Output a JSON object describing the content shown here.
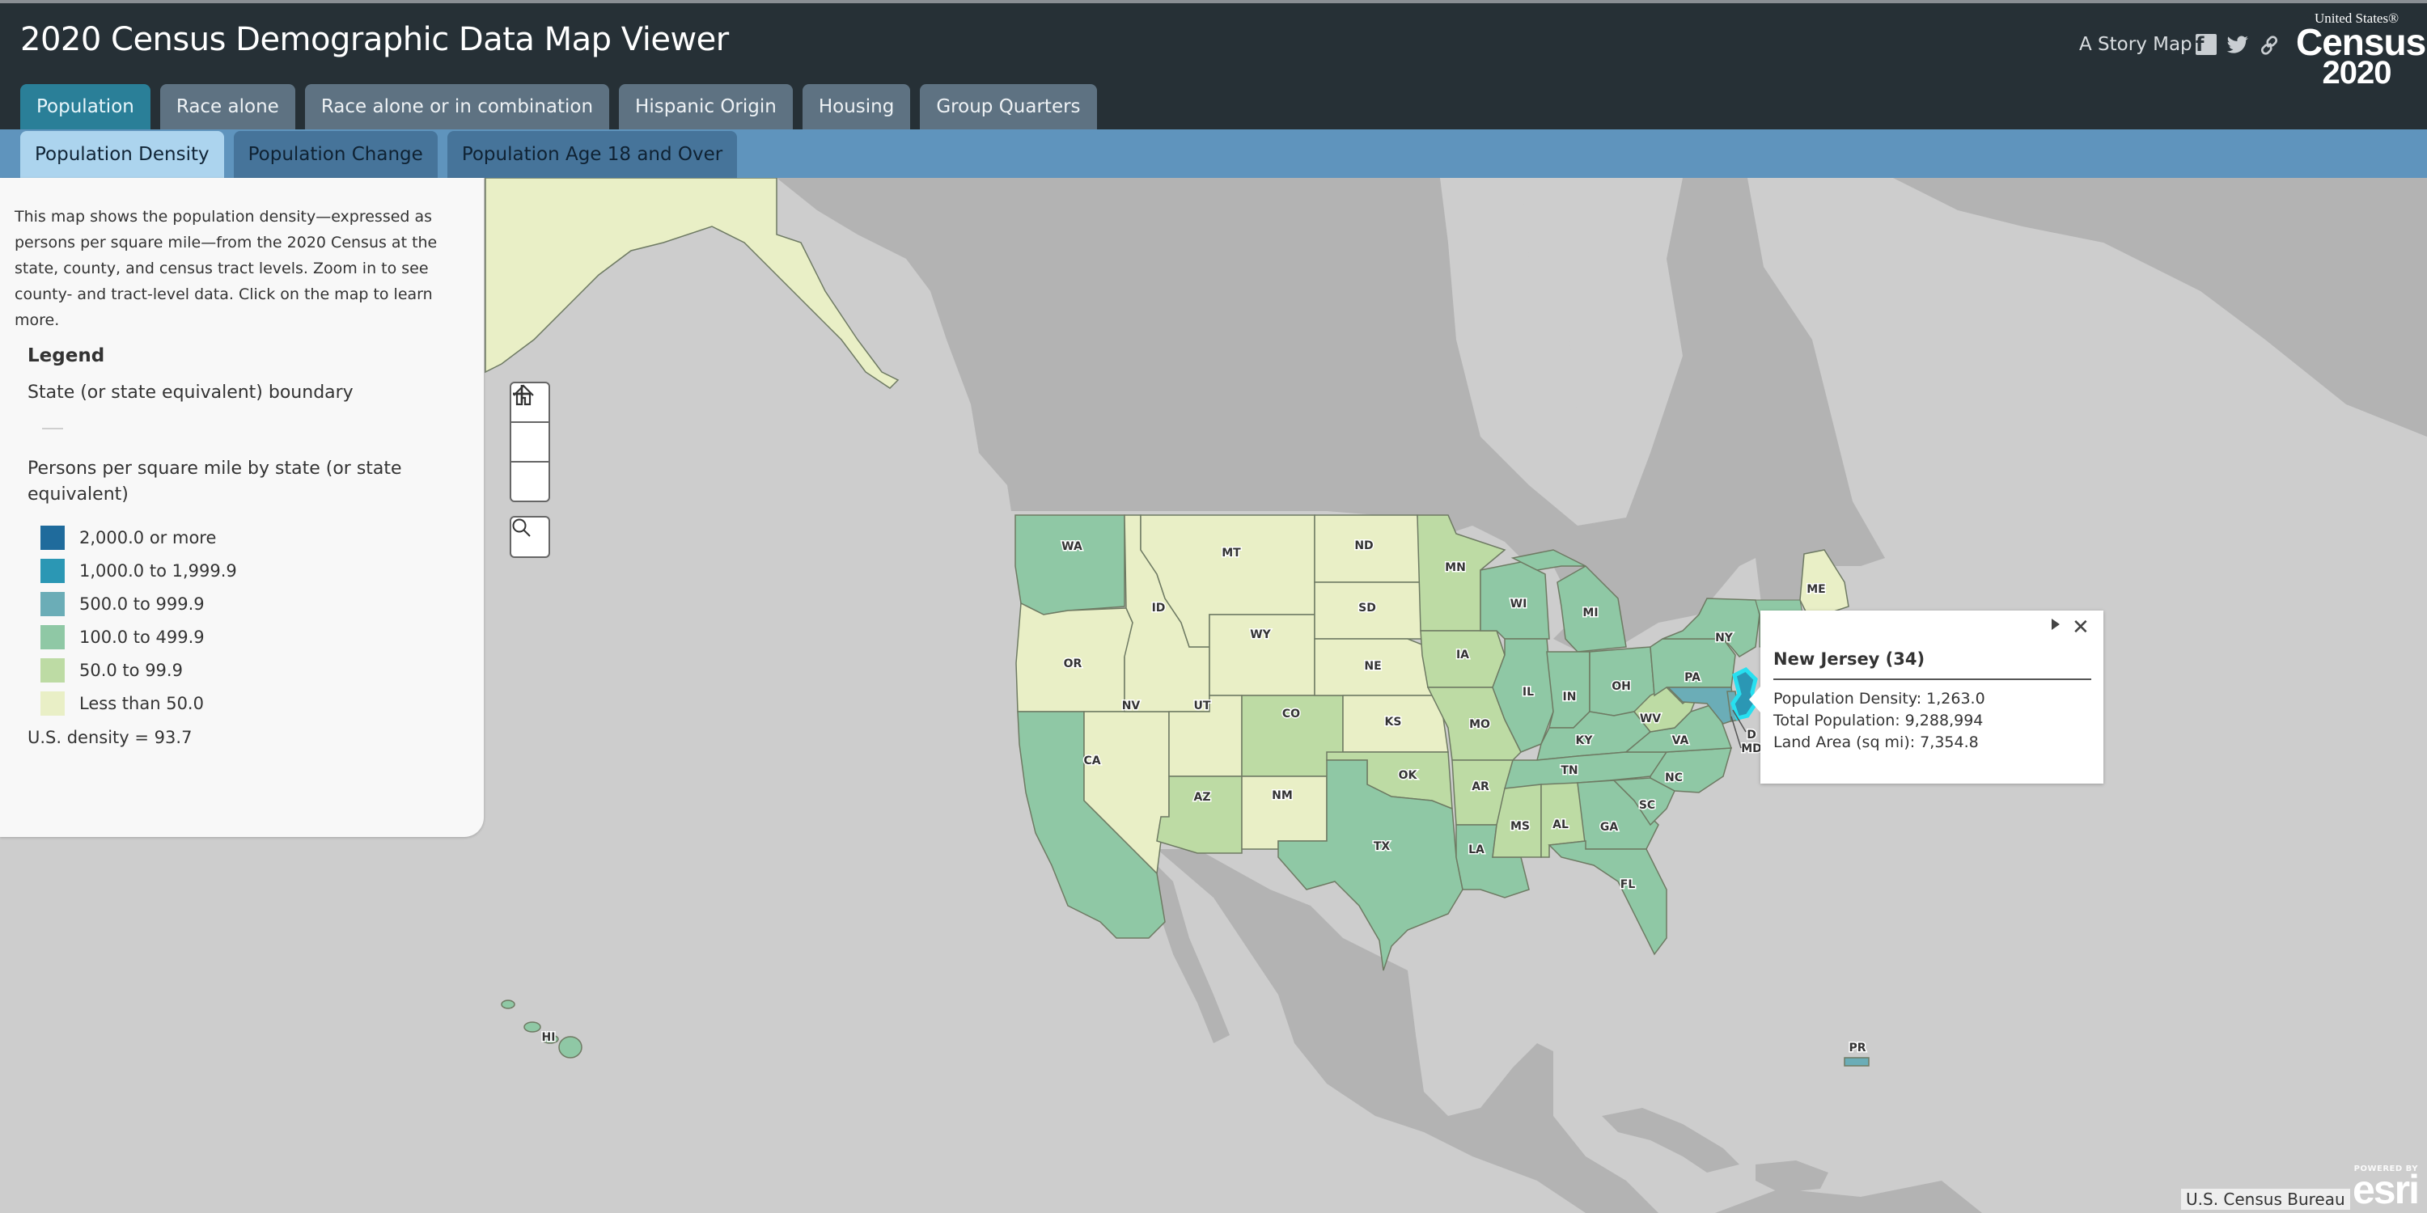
{
  "header": {
    "title": "2020 Census Demographic Data Map Viewer",
    "story_map": "A Story Map",
    "social_icons": [
      "facebook-icon",
      "twitter-icon",
      "link-icon"
    ],
    "logo": {
      "line1": "United States®",
      "line2": "Census",
      "line3": "2020"
    }
  },
  "tabs": [
    {
      "label": "Population",
      "active": true
    },
    {
      "label": "Race alone",
      "active": false
    },
    {
      "label": "Race alone or in combination",
      "active": false
    },
    {
      "label": "Hispanic Origin",
      "active": false
    },
    {
      "label": "Housing",
      "active": false
    },
    {
      "label": "Group Quarters",
      "active": false
    }
  ],
  "subtabs": [
    {
      "label": "Population Density",
      "active": true
    },
    {
      "label": "Population Change",
      "active": false
    },
    {
      "label": "Population Age 18 and Over",
      "active": false
    }
  ],
  "panel": {
    "description": "This map shows the population density—expressed as persons per square mile—from the 2020 Census at the state, county, and census tract levels. Zoom in to see county- and tract-level data. Click on the map to learn more.",
    "legend_title": "Legend",
    "boundary_label": "State (or state equivalent) boundary",
    "density_label": "Persons per square mile by state (or state equivalent)",
    "legend_items": [
      {
        "label": "2,000.0 or more",
        "color": "#1f6b9c"
      },
      {
        "label": "1,000.0 to 1,999.9",
        "color": "#2b97b4"
      },
      {
        "label": "500.0 to 999.9",
        "color": "#6badb7"
      },
      {
        "label": "100.0 to 499.9",
        "color": "#8fc8a5"
      },
      {
        "label": "50.0 to 99.9",
        "color": "#bddba4"
      },
      {
        "label": "Less than 50.0",
        "color": "#e9efc6"
      }
    ],
    "us_density": "U.S. density = 93.7"
  },
  "map_controls": {
    "zoom_in": "+",
    "home": "home",
    "zoom_out": "−",
    "search": "search"
  },
  "map": {
    "colors": {
      "ocean": "#cdcdcd",
      "land_other": "#b3b3b3",
      "state_border": "#6e7a63",
      "selected_outline": "#27e0f0"
    },
    "states": [
      {
        "abbr": "WA",
        "class": "100.0 to 499.9"
      },
      {
        "abbr": "OR",
        "class": "Less than 50.0"
      },
      {
        "abbr": "CA",
        "class": "100.0 to 499.9"
      },
      {
        "abbr": "ID",
        "class": "Less than 50.0"
      },
      {
        "abbr": "NV",
        "class": "Less than 50.0"
      },
      {
        "abbr": "MT",
        "class": "Less than 50.0"
      },
      {
        "abbr": "WY",
        "class": "Less than 50.0"
      },
      {
        "abbr": "UT",
        "class": "Less than 50.0"
      },
      {
        "abbr": "AZ",
        "class": "50.0 to 99.9"
      },
      {
        "abbr": "CO",
        "class": "50.0 to 99.9"
      },
      {
        "abbr": "NM",
        "class": "Less than 50.0"
      },
      {
        "abbr": "ND",
        "class": "Less than 50.0"
      },
      {
        "abbr": "SD",
        "class": "Less than 50.0"
      },
      {
        "abbr": "NE",
        "class": "Less than 50.0"
      },
      {
        "abbr": "KS",
        "class": "Less than 50.0"
      },
      {
        "abbr": "OK",
        "class": "50.0 to 99.9"
      },
      {
        "abbr": "TX",
        "class": "100.0 to 499.9"
      },
      {
        "abbr": "MN",
        "class": "50.0 to 99.9"
      },
      {
        "abbr": "IA",
        "class": "50.0 to 99.9"
      },
      {
        "abbr": "MO",
        "class": "50.0 to 99.9"
      },
      {
        "abbr": "AR",
        "class": "50.0 to 99.9"
      },
      {
        "abbr": "LA",
        "class": "100.0 to 499.9"
      },
      {
        "abbr": "WI",
        "class": "100.0 to 499.9"
      },
      {
        "abbr": "IL",
        "class": "100.0 to 499.9"
      },
      {
        "abbr": "MI",
        "class": "100.0 to 499.9"
      },
      {
        "abbr": "IN",
        "class": "100.0 to 499.9"
      },
      {
        "abbr": "OH",
        "class": "100.0 to 499.9"
      },
      {
        "abbr": "KY",
        "class": "100.0 to 499.9"
      },
      {
        "abbr": "TN",
        "class": "100.0 to 499.9"
      },
      {
        "abbr": "MS",
        "class": "50.0 to 99.9"
      },
      {
        "abbr": "AL",
        "class": "50.0 to 99.9"
      },
      {
        "abbr": "GA",
        "class": "100.0 to 499.9"
      },
      {
        "abbr": "FL",
        "class": "100.0 to 499.9"
      },
      {
        "abbr": "SC",
        "class": "100.0 to 499.9"
      },
      {
        "abbr": "NC",
        "class": "100.0 to 499.9"
      },
      {
        "abbr": "VA",
        "class": "100.0 to 499.9"
      },
      {
        "abbr": "WV",
        "class": "50.0 to 99.9"
      },
      {
        "abbr": "PA",
        "class": "100.0 to 499.9"
      },
      {
        "abbr": "NY",
        "class": "100.0 to 499.9"
      },
      {
        "abbr": "MD",
        "class": "500.0 to 999.9"
      },
      {
        "abbr": "DE",
        "class": "500.0 to 999.9"
      },
      {
        "abbr": "NJ",
        "class": "1,000.0 to 1,999.9",
        "selected": true
      },
      {
        "abbr": "ME",
        "class": "Less than 50.0"
      },
      {
        "abbr": "AK",
        "class": "Less than 50.0"
      },
      {
        "abbr": "HI",
        "class": "100.0 to 499.9"
      },
      {
        "abbr": "PR",
        "class": "500.0 to 999.9"
      }
    ],
    "labels": [
      "WA",
      "OR",
      "CA",
      "ID",
      "NV",
      "MT",
      "WY",
      "UT",
      "AZ",
      "CO",
      "NM",
      "ND",
      "SD",
      "NE",
      "KS",
      "OK",
      "TX",
      "MN",
      "IA",
      "MO",
      "AR",
      "LA",
      "WI",
      "IL",
      "MI",
      "IN",
      "OH",
      "KY",
      "TN",
      "MS",
      "AL",
      "GA",
      "FL",
      "SC",
      "NC",
      "VA",
      "WV",
      "PA",
      "NY",
      "ME",
      "MD",
      "D",
      "HI",
      "PR"
    ]
  },
  "popup": {
    "title": "New Jersey (34)",
    "fields": [
      "Population Density: 1,263.0",
      "Total Population: 9,288,994",
      "Land Area (sq mi): 7,354.8"
    ]
  },
  "attribution": "U.S. Census Bureau",
  "esri": {
    "powered": "POWERED BY",
    "word": "esri"
  }
}
